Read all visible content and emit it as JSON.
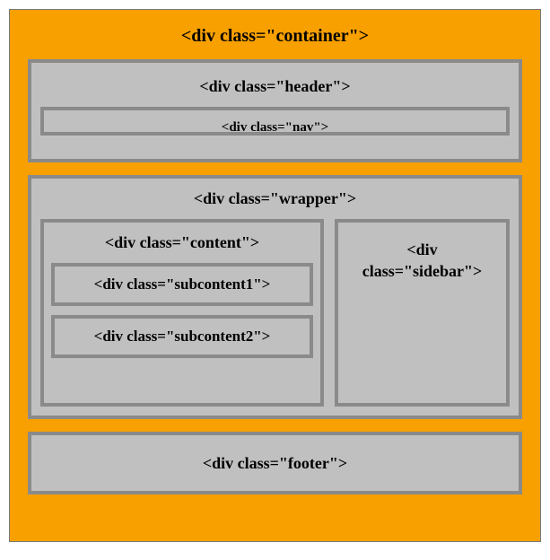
{
  "container": {
    "label": "<div class=\"container\">"
  },
  "header": {
    "label": "<div class=\"header\">"
  },
  "nav": {
    "label": "<div class=\"nav\">"
  },
  "wrapper": {
    "label": "<div class=\"wrapper\">"
  },
  "content": {
    "label": "<div class=\"content\">"
  },
  "subcontent1": {
    "label": "<div class=\"subcontent1\">"
  },
  "subcontent2": {
    "label": "<div class=\"subcontent2\">"
  },
  "sidebar": {
    "label_line1": "<div",
    "label_line2": "class=\"sidebar\">"
  },
  "footer": {
    "label": "<div class=\"footer\">"
  }
}
